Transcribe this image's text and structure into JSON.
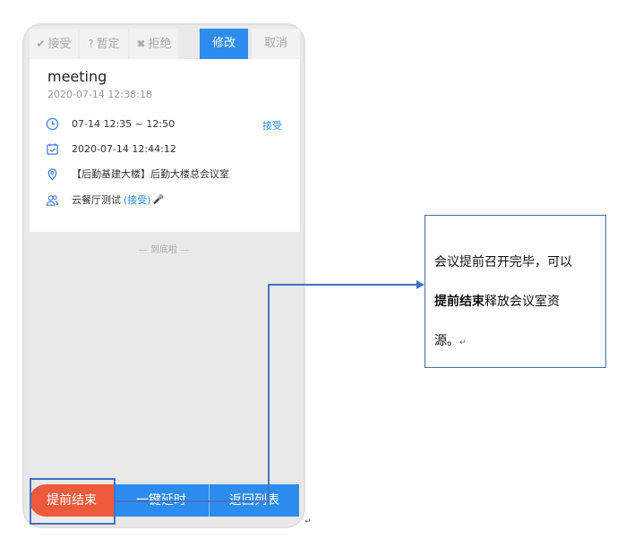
{
  "tabs": [
    {
      "icon": "✔",
      "label": "接受"
    },
    {
      "icon": "?",
      "label": "暂定"
    },
    {
      "icon": "✖",
      "label": "拒绝"
    },
    {
      "icon": "",
      "label": "修改"
    },
    {
      "icon": "",
      "label": "取消"
    }
  ],
  "meeting": {
    "title": "meeting",
    "created_at": "2020-07-14 12:38:18",
    "time_range": "07-14 12:35 ~ 12:50",
    "accept_link": "接受",
    "reminder_time": "2020-07-14 12:44:12",
    "location": "【后勤基建大楼】后勤大楼总会议室",
    "attendee_name": "云餐厅测试",
    "attendee_status": "(接受)",
    "attendee_icon": "🎤"
  },
  "list_end_text": "— 到底啦 —",
  "bottom_buttons": [
    {
      "label": "提前结束"
    },
    {
      "label": "一键延时"
    },
    {
      "label": "返回列表"
    }
  ],
  "callout": {
    "text_part1": "会议提前召开完毕，可以",
    "text_bold": "提前结束",
    "text_part2": "释放会议室资",
    "text_part3": "源。",
    "para_mark": "↵"
  },
  "outer_para_mark": "↵",
  "colors": {
    "primary_blue": "#2d8cf0",
    "end_red": "#ef5a3c",
    "annotation_blue": "#4472c4"
  }
}
